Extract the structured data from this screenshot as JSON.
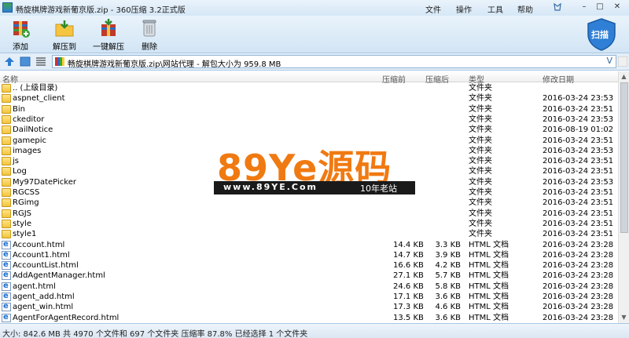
{
  "window": {
    "title": "畅旋棋牌游戏新葡京版.zip - 360压缩 3.2正式版",
    "menu": [
      "文件",
      "操作",
      "工具",
      "帮助"
    ]
  },
  "toolbar": {
    "add": "添加",
    "extract_to": "解压到",
    "one_click_extract": "一键解压",
    "delete": "删除",
    "scan": "扫描"
  },
  "address": {
    "path": "畅旋棋牌游戏新葡京版.zip\\网站代理 - 解包大小为 959.8 MB",
    "dropdown": "V"
  },
  "columns": {
    "name": "名称",
    "compressed": "压缩前",
    "original": "压缩后",
    "type": "类型",
    "modified": "修改日期"
  },
  "files": [
    {
      "name": ".. (上级目录)",
      "icon": "folder-icon",
      "csize": "",
      "osize": "",
      "type": "文件夹",
      "date": ""
    },
    {
      "name": "aspnet_client",
      "icon": "folder-icon",
      "csize": "",
      "osize": "",
      "type": "文件夹",
      "date": "2016-03-24 23:53"
    },
    {
      "name": "Bin",
      "icon": "folder-icon",
      "csize": "",
      "osize": "",
      "type": "文件夹",
      "date": "2016-03-24 23:51"
    },
    {
      "name": "ckeditor",
      "icon": "folder-icon",
      "csize": "",
      "osize": "",
      "type": "文件夹",
      "date": "2016-03-24 23:53"
    },
    {
      "name": "DailNotice",
      "icon": "folder-icon",
      "csize": "",
      "osize": "",
      "type": "文件夹",
      "date": "2016-08-19 01:02"
    },
    {
      "name": "gamepic",
      "icon": "folder-icon",
      "csize": "",
      "osize": "",
      "type": "文件夹",
      "date": "2016-03-24 23:51"
    },
    {
      "name": "images",
      "icon": "folder-icon",
      "csize": "",
      "osize": "",
      "type": "文件夹",
      "date": "2016-03-24 23:53"
    },
    {
      "name": "js",
      "icon": "folder-icon",
      "csize": "",
      "osize": "",
      "type": "文件夹",
      "date": "2016-03-24 23:51"
    },
    {
      "name": "Log",
      "icon": "folder-icon",
      "csize": "",
      "osize": "",
      "type": "文件夹",
      "date": "2016-03-24 23:51"
    },
    {
      "name": "My97DatePicker",
      "icon": "folder-icon",
      "csize": "",
      "osize": "",
      "type": "文件夹",
      "date": "2016-03-24 23:53"
    },
    {
      "name": "RGCSS",
      "icon": "folder-icon",
      "csize": "",
      "osize": "",
      "type": "文件夹",
      "date": "2016-03-24 23:51"
    },
    {
      "name": "RGimg",
      "icon": "folder-icon",
      "csize": "",
      "osize": "",
      "type": "文件夹",
      "date": "2016-03-24 23:51"
    },
    {
      "name": "RGJS",
      "icon": "folder-icon",
      "csize": "",
      "osize": "",
      "type": "文件夹",
      "date": "2016-03-24 23:51"
    },
    {
      "name": "style",
      "icon": "folder-icon",
      "csize": "",
      "osize": "",
      "type": "文件夹",
      "date": "2016-03-24 23:51"
    },
    {
      "name": "style1",
      "icon": "folder-icon",
      "csize": "",
      "osize": "",
      "type": "文件夹",
      "date": "2016-03-24 23:51"
    },
    {
      "name": "Account.html",
      "icon": "html-file-icon",
      "csize": "14.4 KB",
      "osize": "3.3 KB",
      "type": "HTML 文档",
      "date": "2016-03-24 23:28"
    },
    {
      "name": "Account1.html",
      "icon": "html-file-icon",
      "csize": "14.7 KB",
      "osize": "3.9 KB",
      "type": "HTML 文档",
      "date": "2016-03-24 23:28"
    },
    {
      "name": "AccountList.html",
      "icon": "html-file-icon",
      "csize": "16.6 KB",
      "osize": "4.2 KB",
      "type": "HTML 文档",
      "date": "2016-03-24 23:28"
    },
    {
      "name": "AddAgentManager.html",
      "icon": "html-file-icon",
      "csize": "27.1 KB",
      "osize": "5.7 KB",
      "type": "HTML 文档",
      "date": "2016-03-24 23:28"
    },
    {
      "name": "agent.html",
      "icon": "html-file-icon",
      "csize": "24.6 KB",
      "osize": "5.8 KB",
      "type": "HTML 文档",
      "date": "2016-03-24 23:28"
    },
    {
      "name": "agent_add.html",
      "icon": "html-file-icon",
      "csize": "17.1 KB",
      "osize": "3.6 KB",
      "type": "HTML 文档",
      "date": "2016-03-24 23:28"
    },
    {
      "name": "agent_win.html",
      "icon": "html-file-icon",
      "csize": "17.3 KB",
      "osize": "4.6 KB",
      "type": "HTML 文档",
      "date": "2016-03-24 23:28"
    },
    {
      "name": "AgentForAgentRecord.html",
      "icon": "html-file-icon",
      "csize": "13.5 KB",
      "osize": "3.6 KB",
      "type": "HTML 文档",
      "date": "2016-03-24 23:28"
    }
  ],
  "watermark": {
    "logo": "89Ye源码",
    "url": "www.89YE.Com",
    "tagline": "10年老站"
  },
  "status": "大小: 842.6 MB 共 4970 个文件和 697 个文件夹 压缩率 87.8% 已经选择 1 个文件夹",
  "colors": {
    "accent": "#2a7fd4",
    "folder": "#f2c43c",
    "watermark": "#f07a12"
  }
}
